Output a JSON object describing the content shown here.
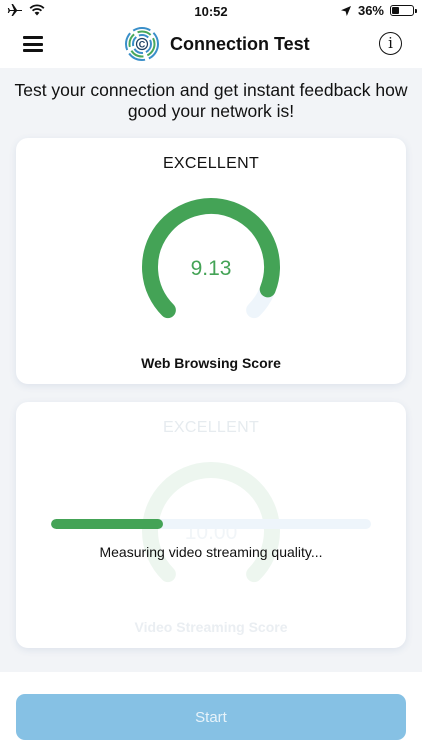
{
  "status_bar": {
    "time": "10:52",
    "battery": "36%",
    "battery_level": 0.36
  },
  "nav": {
    "title": "Connection Test",
    "info_glyph": "i",
    "logo_letter": "C"
  },
  "subtitle": "Test your connection and get instant feedback how good your network is!",
  "cards": [
    {
      "rating": "EXCELLENT",
      "score": "9.13",
      "score_value": 9.13,
      "score_max": 10,
      "label": "Web Browsing Score"
    },
    {
      "rating": "EXCELLENT",
      "score": "10.00",
      "label": "Video Streaming Score"
    }
  ],
  "video_test": {
    "progress": 0.35,
    "status": "Measuring video streaming quality..."
  },
  "start_button": {
    "label": "Start"
  },
  "colors": {
    "accent_green": "#44a356",
    "gauge_track": "#eef5fb",
    "start_button": "#86c1e4",
    "faded_green": "#edf6ef"
  }
}
